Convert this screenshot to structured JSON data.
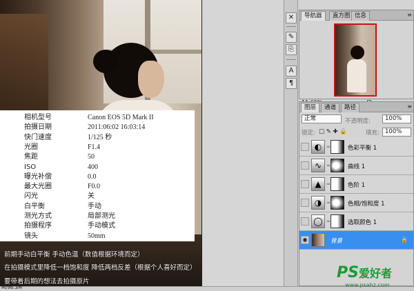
{
  "exif": [
    {
      "k": "相机型号",
      "v": "Canon EOS 5D Mark II"
    },
    {
      "k": "拍摄日期",
      "v": "2011:06:02 16:03:14"
    },
    {
      "k": "快门速度",
      "v": "1/125 秒"
    },
    {
      "k": "光圈",
      "v": "F1.4"
    },
    {
      "k": "焦距",
      "v": "50"
    },
    {
      "k": "ISO",
      "v": "400"
    },
    {
      "k": "曝光补偿",
      "v": "0.0"
    },
    {
      "k": "最大光圈",
      "v": "F0.0"
    },
    {
      "k": "闪光",
      "v": "关"
    },
    {
      "k": "白平衡",
      "v": "手动"
    },
    {
      "k": "测光方式",
      "v": "局部测光"
    },
    {
      "k": "拍摄程序",
      "v": "手动模式"
    },
    {
      "k": "镜头",
      "v": "50mm"
    }
  ],
  "captions": [
    "前期手动白平衡 手动色温（数值根据环境而定）",
    "在拍摄模式里降低一档饱和度 降低两档反差（根据个人喜好而定）",
    "要带着后期的想法去拍摄原片"
  ],
  "status": {
    "text": "M/96.3M"
  },
  "navigator": {
    "tabs": [
      "导航器",
      "直方图",
      "信息"
    ],
    "zoom": "11.65%"
  },
  "layers_panel": {
    "tabs": [
      "图层",
      "通道",
      "路径"
    ],
    "blend_mode": "正常",
    "opacity_label": "不透明度:",
    "opacity_value": "100%",
    "lock_label": "锁定:",
    "fill_label": "填充:",
    "fill_value": "100%",
    "layers": [
      {
        "name": "色彩平衡 1",
        "active": false
      },
      {
        "name": "曲线 1",
        "active": false
      },
      {
        "name": "色阶 1",
        "active": false
      },
      {
        "name": "色相/饱和度 1",
        "active": false
      },
      {
        "name": "选取颜色 1",
        "active": false
      },
      {
        "name": "背景",
        "active": true
      }
    ]
  },
  "watermark": {
    "ps": "PS",
    "cn": "爱好者",
    "url": "www.psahz.com"
  },
  "colors": {
    "accent": "#3a8ef0",
    "watermark": "#1d9a36",
    "nav_frame": "#d01010"
  }
}
